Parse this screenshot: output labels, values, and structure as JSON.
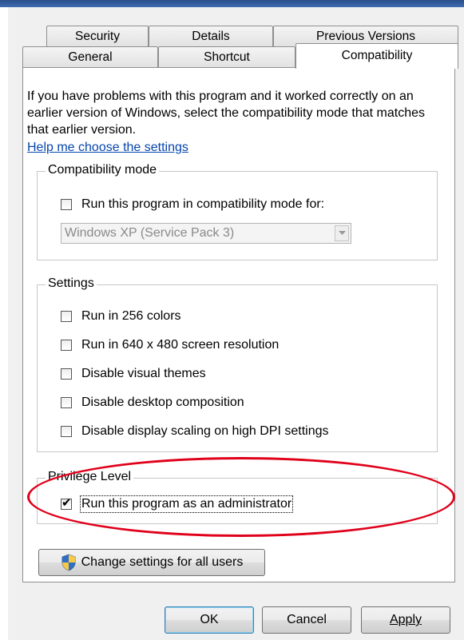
{
  "tabs_row1": [
    "Security",
    "Details",
    "Previous Versions"
  ],
  "tabs_row2": [
    "General",
    "Shortcut",
    "Compatibility"
  ],
  "intro_text": "If you have problems with this program and it worked correctly on an earlier version of Windows, select the compatibility mode that matches that earlier version.",
  "help_link": "Help me choose the settings",
  "compat_mode": {
    "legend": "Compatibility mode",
    "checkbox_label": "Run this program in compatibility mode for:",
    "checked": false,
    "selected_os": "Windows XP (Service Pack 3)"
  },
  "settings": {
    "legend": "Settings",
    "items": [
      {
        "label": "Run in 256 colors",
        "checked": false
      },
      {
        "label": "Run in 640 x 480 screen resolution",
        "checked": false
      },
      {
        "label": "Disable visual themes",
        "checked": false
      },
      {
        "label": "Disable desktop composition",
        "checked": false
      },
      {
        "label": "Disable display scaling on high DPI settings",
        "checked": false
      }
    ]
  },
  "privilege": {
    "legend": "Privilege Level",
    "checkbox_label": "Run this program as an administrator",
    "checked": true,
    "check_glyph": "✔"
  },
  "change_all_users_label": "Change settings for all users",
  "buttons": {
    "ok": "OK",
    "cancel": "Cancel",
    "apply": "Apply"
  },
  "colors": {
    "highlight_oval": "#e0001a",
    "link": "#0645ad"
  },
  "icons": {
    "shield": "uac-shield-icon"
  }
}
